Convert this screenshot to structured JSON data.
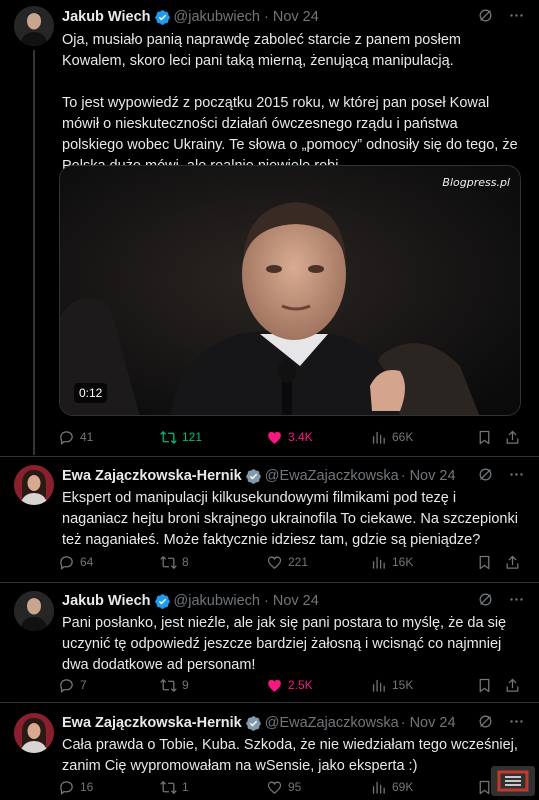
{
  "tweets": [
    {
      "author": "Jakub Wiech",
      "handle": "@jakubwiech",
      "date": "· Nov 24",
      "paragraphs": [
        "Oja, musiało panią naprawdę zaboleć starcie z panem posłem Kowalem, skoro leci pani taką mierną, żenującą manipulacją.",
        "To jest wypowiedź z początku 2015 roku, w której pan poseł Kowal mówił o nieskuteczności działań ówczesnego rządu i państwa polskiego wobec Ukrainy. Te słowa o „pomocy” odnosiły się do tego, że Polska dużo mówi, ale realnie niewiele robi."
      ],
      "media": {
        "watermark": "Blogpress.pl",
        "duration": "0:12"
      },
      "stats": {
        "replies": "41",
        "reposts": "121",
        "likes": "3.4K",
        "views": "66K"
      }
    },
    {
      "author": "Ewa Zajączkowska-Hernik",
      "handle": "@EwaZajaczkowska",
      "date": "· Nov 24",
      "paragraphs": [
        "Ekspert od manipulacji kilkusekundowymi filmikami pod tezę i naganiacz hejtu broni skrajnego ukrainofila To ciekawe. Na szczepionki też naganiałeś. Może faktycznie idziesz tam, gdzie są pieniądze?"
      ],
      "stats": {
        "replies": "64",
        "reposts": "8",
        "likes": "221",
        "views": "16K"
      }
    },
    {
      "author": "Jakub Wiech",
      "handle": "@jakubwiech",
      "date": "· Nov 24",
      "paragraphs": [
        "Pani posłanko, jest nieźle, ale jak się pani postara to myślę, że da się uczynić tę odpowiedź jeszcze bardziej żałosną i wcisnąć co najmniej dwa dodatkowe ad personam!"
      ],
      "stats": {
        "replies": "7",
        "reposts": "9",
        "likes": "2.5K",
        "views": "15K"
      }
    },
    {
      "author": "Ewa Zajączkowska-Hernik",
      "handle": "@EwaZajaczkowska",
      "date": "· Nov 24",
      "paragraphs": [
        "Cała prawda o Tobie, Kuba. Szkoda, że nie wiedziałam tego wcześniej, zanim Cię wypromowałam na wSensie, jako eksperta :)"
      ],
      "stats": {
        "replies": "16",
        "reposts": "1",
        "likes": "95",
        "views": "69K"
      }
    }
  ],
  "colors": {
    "background": "#000000",
    "text": "#e7e9ea",
    "muted": "#71767b",
    "verified": "#1d9bf0",
    "repost_active": "#00ba7c",
    "like_active": "#f91880",
    "divider": "#2f3336"
  },
  "icons": [
    "verified-badge-icon",
    "grok-icon",
    "more-icon",
    "reply-icon",
    "repost-icon",
    "like-icon",
    "views-icon",
    "bookmark-icon",
    "share-icon"
  ]
}
